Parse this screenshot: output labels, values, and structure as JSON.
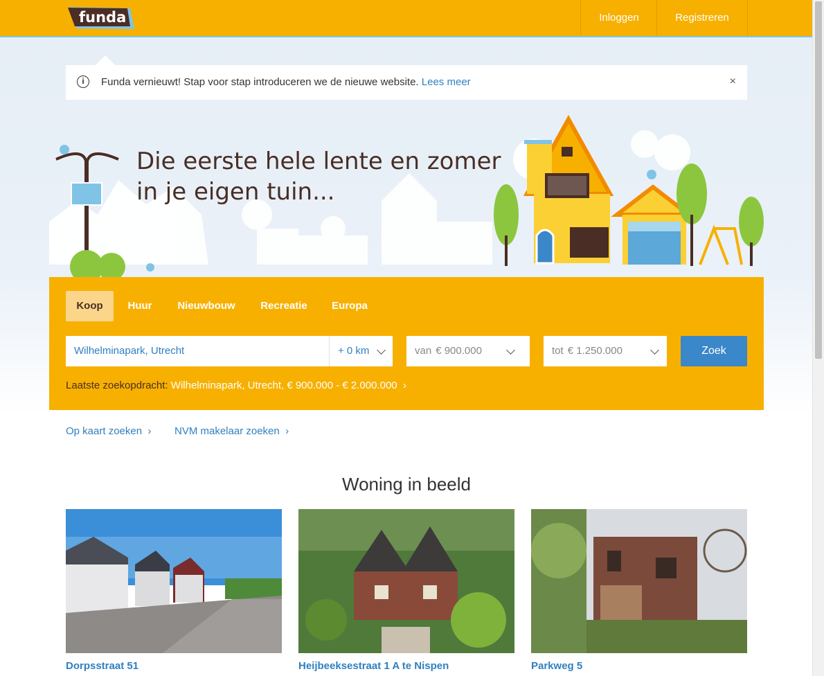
{
  "brand": {
    "logo_text": "funda",
    "color": "#f7b000",
    "link_color": "#2f80c0"
  },
  "header": {
    "login": "Inloggen",
    "register": "Registreren"
  },
  "notice": {
    "text": "Funda vernieuwt! Stap voor stap introduceren we de nieuwe website.",
    "link": "Lees meer",
    "close": "×",
    "info_icon": "i"
  },
  "hero": {
    "title_line1": "Die eerste hele lente en zomer",
    "title_line2": "in je eigen tuin..."
  },
  "search": {
    "tabs": [
      "Koop",
      "Huur",
      "Nieuwbouw",
      "Recreatie",
      "Europa"
    ],
    "active_tab": "Koop",
    "location_value": "Wilhelminapark, Utrecht",
    "radius": "+ 0 km",
    "min_price_prefix": "van",
    "min_price": "€ 900.000",
    "max_price_prefix": "tot",
    "max_price": "€ 1.250.000",
    "submit": "Zoek",
    "last_search_label": "Laatste zoekopdracht:",
    "last_search_value": "Wilhelminapark, Utrecht, € 900.000 - € 2.000.000"
  },
  "quick_links": [
    "Op kaart zoeken",
    "NVM makelaar zoeken"
  ],
  "featured": {
    "title": "Woning in beeld",
    "items": [
      {
        "caption": "Dorpsstraat 51"
      },
      {
        "caption": "Heijbeeksestraat 1 A te Nispen"
      },
      {
        "caption": "Parkweg 5"
      }
    ]
  }
}
